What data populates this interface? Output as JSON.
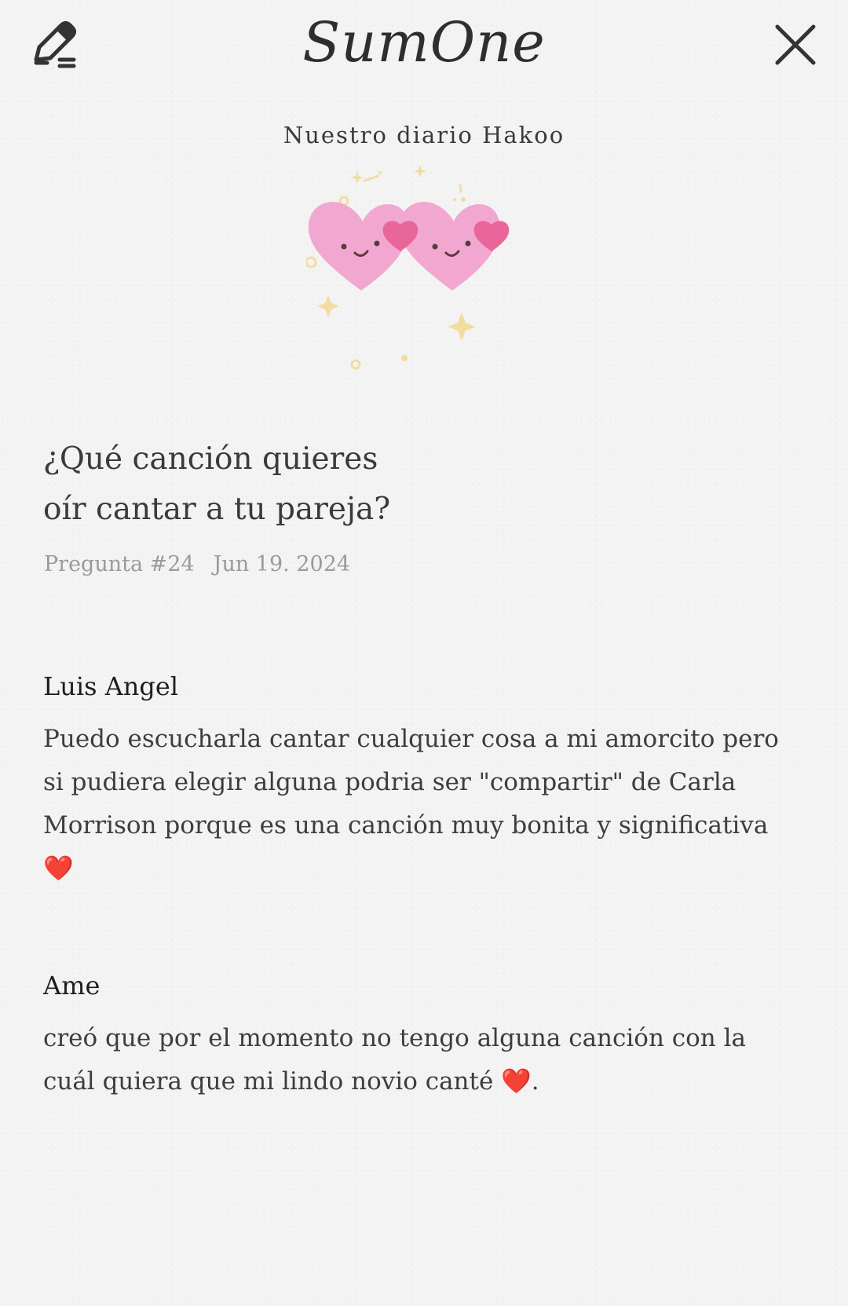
{
  "app": {
    "logo_text": "SumOne"
  },
  "diary": {
    "title": "Nuestro diario Hakoo"
  },
  "question": {
    "text": "¿Qué canción quieres\noír cantar a tu pareja?",
    "number_label": "Pregunta #24",
    "date": "Jun 19. 2024"
  },
  "answers": [
    {
      "name": "Luis Angel",
      "text": "Puedo escucharla cantar cualquier cosa a mi amorcito pero si pudiera elegir alguna podria ser \"compartir\" de Carla Morrison porque es una canción muy bonita y significativa ❤️"
    },
    {
      "name": "Ame",
      "text": "creó que por el momento no tengo alguna canción con la cuál quiera que mi lindo novio canté ❤️."
    }
  ],
  "icons": {
    "edit": "edit-pencil-icon",
    "close": "close-icon",
    "illustration": "twin-hearts-illustration"
  },
  "colors": {
    "background": "#f3f3f3",
    "heart_pink": "#f1a7cf",
    "heart_accent": "#e8669a",
    "sparkle": "#f3dca0",
    "meta_gray": "#9a9a9a"
  }
}
